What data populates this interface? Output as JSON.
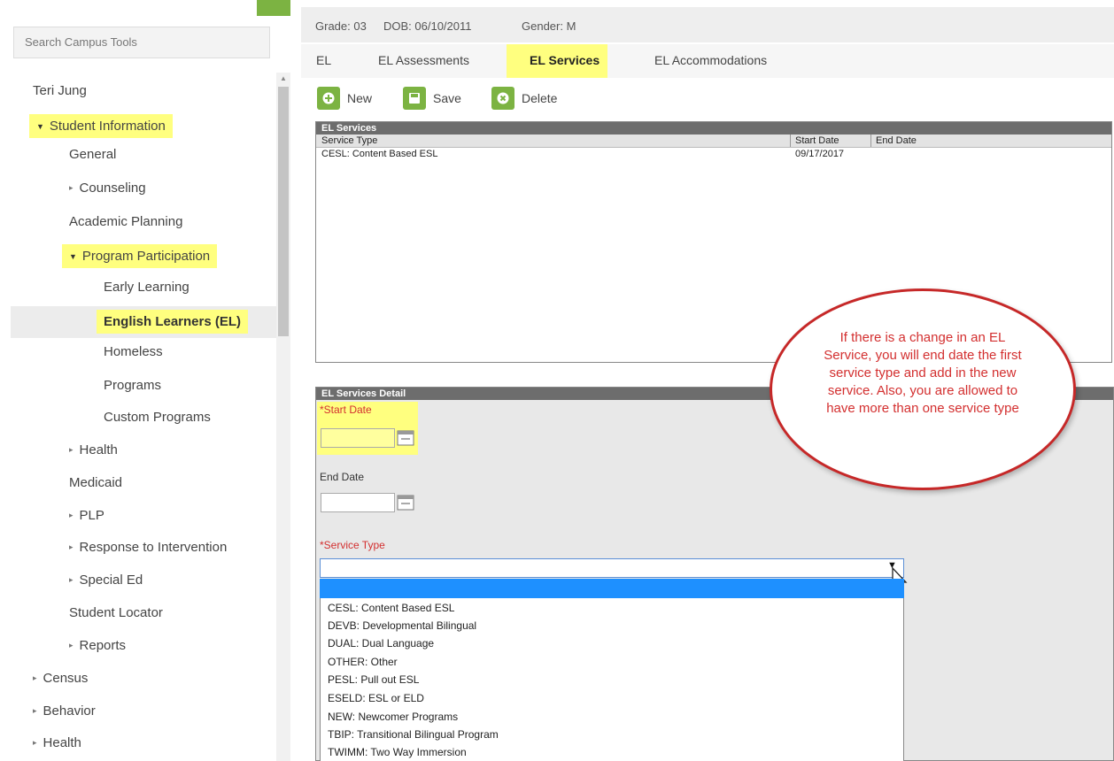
{
  "sidebar": {
    "search_placeholder": "Search Campus Tools",
    "user_name": "Teri Jung",
    "items": [
      {
        "label": "Student Information"
      },
      {
        "label": "General"
      },
      {
        "label": "Counseling"
      },
      {
        "label": "Academic Planning"
      },
      {
        "label": "Program Participation"
      },
      {
        "label": "Early Learning"
      },
      {
        "label": "English Learners (EL)"
      },
      {
        "label": "Homeless"
      },
      {
        "label": "Programs"
      },
      {
        "label": "Custom Programs"
      },
      {
        "label": "Health"
      },
      {
        "label": "Medicaid"
      },
      {
        "label": "PLP"
      },
      {
        "label": "Response to Intervention"
      },
      {
        "label": "Special Ed"
      },
      {
        "label": "Student Locator"
      },
      {
        "label": "Reports"
      },
      {
        "label": "Census"
      },
      {
        "label": "Behavior"
      },
      {
        "label": "Health"
      }
    ]
  },
  "header": {
    "grade": "Grade: 03",
    "dob": "DOB: 06/10/2011",
    "gender": "Gender: M"
  },
  "tabs": [
    {
      "label": "EL"
    },
    {
      "label": "EL Assessments"
    },
    {
      "label": "EL Services",
      "active": true
    },
    {
      "label": "EL Accommodations"
    }
  ],
  "toolbar": {
    "new_label": "New",
    "save_label": "Save",
    "delete_label": "Delete"
  },
  "services_list": {
    "title": "EL Services",
    "columns": [
      "Service Type",
      "Start Date",
      "End Date"
    ],
    "rows": [
      {
        "service_type": "CESL: Content Based ESL",
        "start_date": "09/17/2017",
        "end_date": ""
      }
    ]
  },
  "detail": {
    "title": "EL Services Detail",
    "start_date_label": "*Start Date",
    "end_date_label": "End Date",
    "service_type_label": "*Service Type",
    "service_options": [
      "CESL: Content Based ESL",
      "DEVB: Developmental Bilingual",
      "DUAL: Dual Language",
      "OTHER: Other",
      "PESL: Pull out ESL",
      "ESELD: ESL or ELD",
      "NEW: Newcomer Programs",
      "TBIP: Transitional Bilingual Program",
      "TWIMM: Two Way Immersion"
    ]
  },
  "callout": {
    "text": "If there is a change in an EL Service, you will end date the first service type and add in the new service.  Also, you are allowed to have more than one service type"
  },
  "colors": {
    "accent_green": "#7cb342",
    "highlight_yellow": "#ffff7f",
    "callout_red": "#c62828",
    "selection_blue": "#1e90ff"
  }
}
